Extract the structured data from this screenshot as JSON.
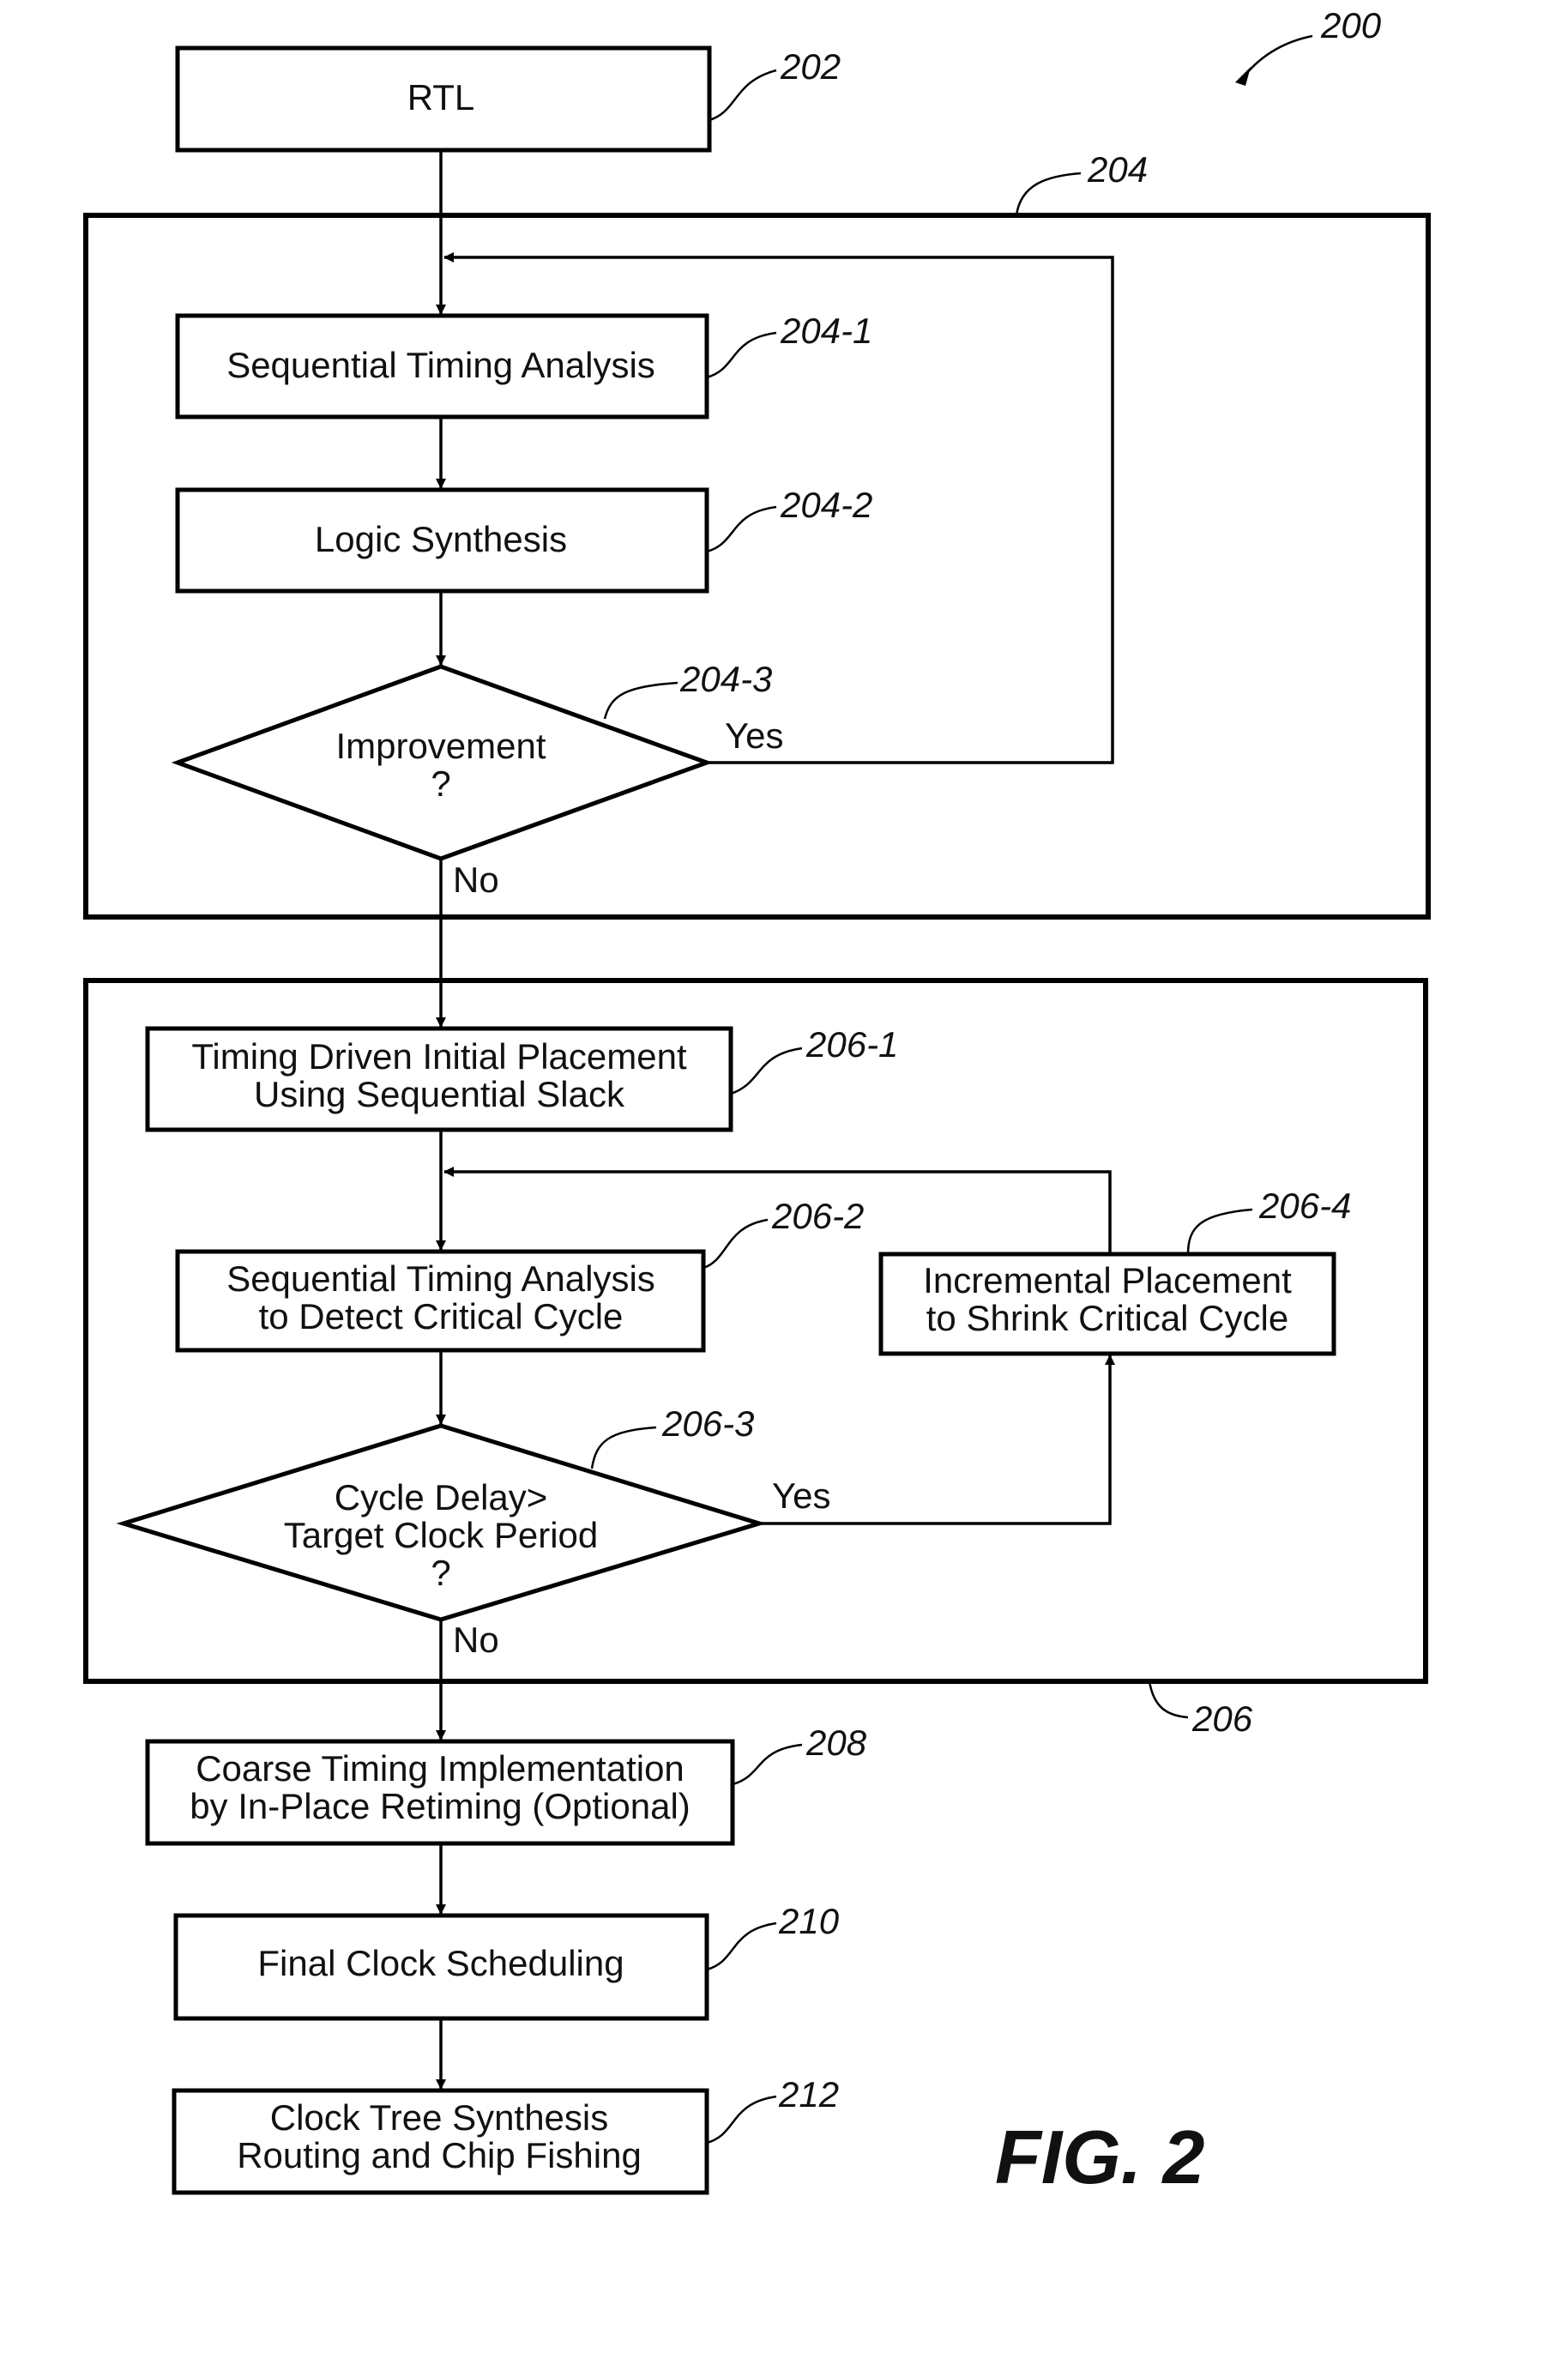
{
  "figure": {
    "label": "FIG. 2",
    "ref": "200"
  },
  "nodes": {
    "rtl": {
      "ref": "202",
      "lines": [
        "RTL"
      ]
    },
    "group_204": {
      "ref": "204"
    },
    "seq_timing": {
      "ref": "204-1",
      "lines": [
        "Sequential Timing Analysis"
      ]
    },
    "logic_synth": {
      "ref": "204-2",
      "lines": [
        "Logic Synthesis"
      ]
    },
    "improvement": {
      "ref": "204-3",
      "lines": [
        "Improvement",
        "?"
      ],
      "yes": "Yes",
      "no": "No"
    },
    "group_206": {
      "ref": "206"
    },
    "initial_place": {
      "ref": "206-1",
      "lines": [
        "Timing Driven Initial Placement",
        "Using Sequential Slack"
      ]
    },
    "seq_timing_cycle": {
      "ref": "206-2",
      "lines": [
        "Sequential Timing Analysis",
        "to Detect Critical Cycle"
      ]
    },
    "cycle_delay": {
      "ref": "206-3",
      "lines": [
        "Cycle Delay>",
        "Target Clock Period",
        "?"
      ],
      "yes": "Yes",
      "no": "No"
    },
    "incremental_place": {
      "ref": "206-4",
      "lines": [
        "Incremental Placement",
        "to Shrink Critical Cycle"
      ]
    },
    "coarse_timing": {
      "ref": "208",
      "lines": [
        "Coarse Timing Implementation",
        "by In-Place Retiming (Optional)"
      ]
    },
    "final_clock": {
      "ref": "210",
      "lines": [
        "Final Clock Scheduling"
      ]
    },
    "clock_tree": {
      "ref": "212",
      "lines": [
        "Clock Tree Synthesis",
        "Routing and Chip Fishing"
      ]
    }
  }
}
